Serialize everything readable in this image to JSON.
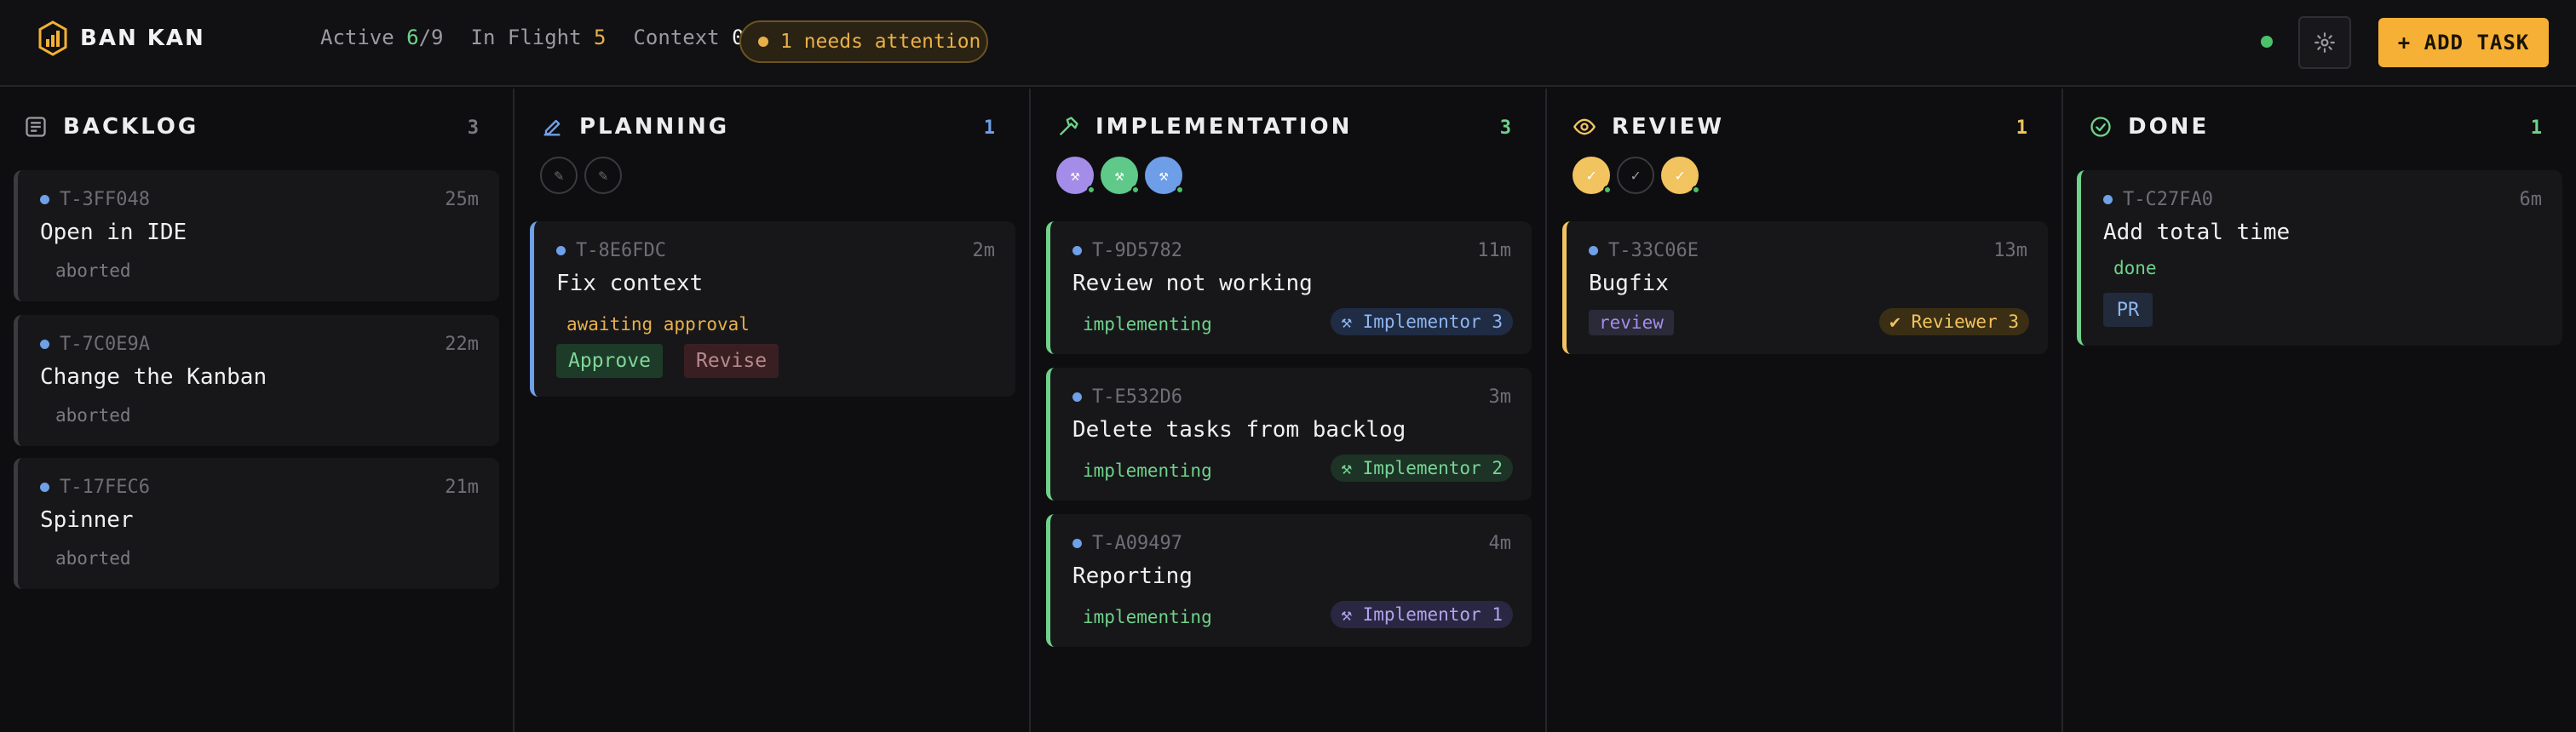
{
  "app": {
    "title": "BAN KAN"
  },
  "stats": {
    "active_label": "Active",
    "active_value": "6",
    "active_total": "/9",
    "inflight_label": "In Flight",
    "inflight_value": "5",
    "context_label": "Context",
    "context_value": "0"
  },
  "attention": {
    "label": "1 needs attention"
  },
  "actions": {
    "add_task": "+ ADD TASK"
  },
  "colors": {
    "accent": "#f5b035",
    "green": "#6fd38a",
    "blue": "#6fa0e8",
    "amber": "#e8b04a",
    "purple": "#a48de8"
  },
  "columns": [
    {
      "title": "BACKLOG",
      "count": "3",
      "icon": "list-icon"
    },
    {
      "title": "PLANNING",
      "count": "1",
      "icon": "pencil-icon"
    },
    {
      "title": "IMPLEMENTATION",
      "count": "3",
      "icon": "hammer-icon"
    },
    {
      "title": "REVIEW",
      "count": "1",
      "icon": "eye-icon"
    },
    {
      "title": "DONE",
      "count": "1",
      "icon": "check-circle-icon"
    }
  ],
  "planning_avatars": [
    "✎",
    "✎"
  ],
  "implementation_avatars": [
    "⚒",
    "⚒",
    "⚒"
  ],
  "review_avatars": [
    "✓",
    "✓",
    "✓"
  ],
  "cards": {
    "backlog": [
      {
        "id": "T-3FF048",
        "time": "25m",
        "title": "Open in IDE",
        "status": "aborted"
      },
      {
        "id": "T-7C0E9A",
        "time": "22m",
        "title": "Change the Kanban",
        "status": "aborted"
      },
      {
        "id": "T-17FEC6",
        "time": "21m",
        "title": "Spinner",
        "status": "aborted"
      }
    ],
    "planning": [
      {
        "id": "T-8E6FDC",
        "time": "2m",
        "title": "Fix context",
        "status": "awaiting approval",
        "approve": "Approve",
        "revise": "Revise"
      }
    ],
    "implementation": [
      {
        "id": "T-9D5782",
        "time": "11m",
        "title": "Review not working",
        "status": "implementing",
        "agent": "⚒ Implementor 3"
      },
      {
        "id": "T-E532D6",
        "time": "3m",
        "title": "Delete tasks from backlog",
        "status": "implementing",
        "agent": "⚒ Implementor 2"
      },
      {
        "id": "T-A09497",
        "time": "4m",
        "title": "Reporting",
        "status": "implementing",
        "agent": "⚒ Implementor 1"
      }
    ],
    "review": [
      {
        "id": "T-33C06E",
        "time": "13m",
        "title": "Bugfix",
        "status": "review",
        "agent": "✔ Reviewer 3"
      }
    ],
    "done": [
      {
        "id": "T-C27FA0",
        "time": "6m",
        "title": "Add total time",
        "status": "done",
        "pr": "PR"
      }
    ]
  }
}
